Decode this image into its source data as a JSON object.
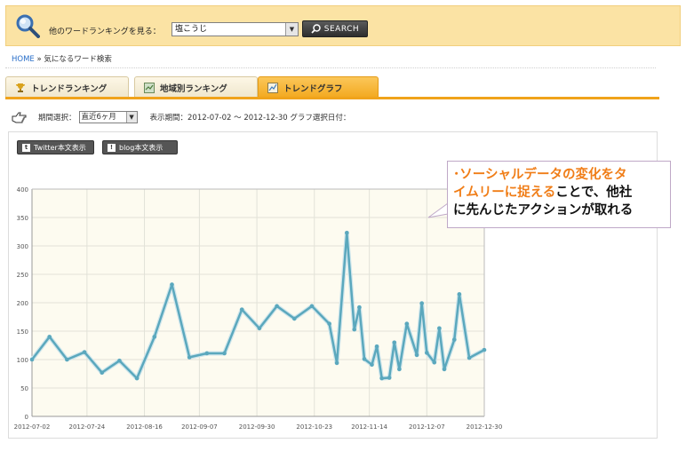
{
  "header": {
    "search_label": "他のワードランキングを見る：",
    "selected_word": "塩こうじ",
    "search_button": "SEARCH",
    "colors": {
      "bar_bg": "#fbe3a4"
    }
  },
  "breadcrumb": {
    "home": "HOME",
    "separator": "»",
    "current": "気になるワード検索"
  },
  "tabs": [
    {
      "label": "トレンドランキング",
      "icon": "trophy-icon",
      "active": false
    },
    {
      "label": "地域別ランキング",
      "icon": "map-icon",
      "active": false
    },
    {
      "label": "トレンドグラフ",
      "icon": "graph-icon",
      "active": true
    }
  ],
  "period": {
    "label": "期間選択：",
    "selected": "直近6ヶ月",
    "display_period_label": "表示期間：2012-07-02 ～ 2012-12-30 グラフ選択日付："
  },
  "buttons": {
    "twitter": "Twitter本文表示",
    "blog": "blog本文表示"
  },
  "callout": {
    "line1_hl": "･ソーシャルデータの変化をタ",
    "line2_hl": "イムリーに捉える",
    "line2_rest": "ことで、他社",
    "line3": "に先んじたアクションが取れる"
  },
  "chart_data": {
    "type": "line",
    "ylim": [
      0,
      400
    ],
    "yticks": [
      "0",
      "50",
      "100",
      "150",
      "200",
      "250",
      "300",
      "350",
      "400"
    ],
    "xticks": [
      "2012-07-02",
      "2012-07-24",
      "2012-08-16",
      "2012-09-07",
      "2012-09-30",
      "2012-10-23",
      "2012-11-14",
      "2012-12-07",
      "2012-12-30"
    ],
    "xlim": [
      "2012-07-02",
      "2012-12-30"
    ],
    "grid": true,
    "series_color": "#5ba8bd",
    "points": [
      [
        "2012-07-02",
        100
      ],
      [
        "2012-07-09",
        140
      ],
      [
        "2012-07-16",
        100
      ],
      [
        "2012-07-23",
        113
      ],
      [
        "2012-07-30",
        77
      ],
      [
        "2012-08-06",
        98
      ],
      [
        "2012-08-13",
        67
      ],
      [
        "2012-08-20",
        140
      ],
      [
        "2012-08-27",
        232
      ],
      [
        "2012-09-03",
        104
      ],
      [
        "2012-09-10",
        111
      ],
      [
        "2012-09-17",
        111
      ],
      [
        "2012-09-24",
        188
      ],
      [
        "2012-10-01",
        155
      ],
      [
        "2012-10-08",
        194
      ],
      [
        "2012-10-15",
        172
      ],
      [
        "2012-10-22",
        194
      ],
      [
        "2012-10-29",
        163
      ],
      [
        "2012-11-01",
        94
      ],
      [
        "2012-11-05",
        323
      ],
      [
        "2012-11-08",
        153
      ],
      [
        "2012-11-10",
        192
      ],
      [
        "2012-11-12",
        101
      ],
      [
        "2012-11-15",
        91
      ],
      [
        "2012-11-17",
        123
      ],
      [
        "2012-11-19",
        67
      ],
      [
        "2012-11-22",
        68
      ],
      [
        "2012-11-24",
        130
      ],
      [
        "2012-11-26",
        83
      ],
      [
        "2012-11-29",
        163
      ],
      [
        "2012-12-03",
        108
      ],
      [
        "2012-12-05",
        199
      ],
      [
        "2012-12-07",
        112
      ],
      [
        "2012-12-10",
        95
      ],
      [
        "2012-12-12",
        155
      ],
      [
        "2012-12-14",
        83
      ],
      [
        "2012-12-18",
        135
      ],
      [
        "2012-12-20",
        215
      ],
      [
        "2012-12-24",
        103
      ],
      [
        "2012-12-30",
        117
      ]
    ]
  }
}
